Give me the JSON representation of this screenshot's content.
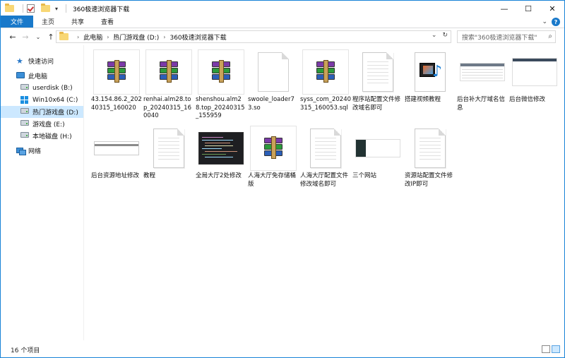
{
  "window": {
    "title": "360极速浏览器下载",
    "controls": [
      "minimize",
      "maximize",
      "close"
    ]
  },
  "ribbon": {
    "tabs": [
      "文件",
      "主页",
      "共享",
      "查看"
    ]
  },
  "address": {
    "crumbs": [
      "此电脑",
      "热门游戏盘 (D:)",
      "360极速浏览器下载"
    ],
    "search_placeholder": "搜索\"360极速浏览器下载\""
  },
  "sidebar": {
    "items": [
      {
        "label": "快速访问",
        "icon": "star-icon"
      },
      {
        "label": "此电脑",
        "icon": "pc-icon"
      },
      {
        "label": "userdisk (B:)",
        "icon": "drive-icon"
      },
      {
        "label": "Win10x64 (C:)",
        "icon": "windows-drive-icon"
      },
      {
        "label": "热门游戏盘 (D:)",
        "icon": "drive-icon",
        "selected": true
      },
      {
        "label": "游戏盘 (E:)",
        "icon": "drive-icon"
      },
      {
        "label": "本地磁盘 (H:)",
        "icon": "drive-icon"
      },
      {
        "label": "网络",
        "icon": "network-icon"
      }
    ]
  },
  "files": [
    {
      "name": "43.154.86.2_20240315_160020",
      "icon": "winrar-archive-icon"
    },
    {
      "name": "renhai.alm28.top_20240315_160040",
      "icon": "winrar-archive-icon"
    },
    {
      "name": "shenshou.alm28.top_20240315_155959",
      "icon": "winrar-archive-icon"
    },
    {
      "name": "swoole_loader73.so",
      "icon": "blank-file-icon"
    },
    {
      "name": "syss_com_20240315_160053.sql",
      "icon": "winrar-archive-icon"
    },
    {
      "name": "程序站配置文件修改域名即可",
      "icon": "text-document-icon"
    },
    {
      "name": "搭建视频教程",
      "icon": "video-file-icon"
    },
    {
      "name": "后台补大厅域名信息",
      "icon": "screenshot-thumbnail"
    },
    {
      "name": "后台微信修改",
      "icon": "screenshot-thumbnail"
    },
    {
      "name": "后台资源地址修改",
      "icon": "screenshot-thumbnail"
    },
    {
      "name": "教程",
      "icon": "text-document-icon"
    },
    {
      "name": "全局大厅2处修改",
      "icon": "code-screenshot-thumbnail"
    },
    {
      "name": "人海大厅免存储桶版",
      "icon": "winrar-archive-icon"
    },
    {
      "name": "人海大厅配置文件修改域名即可",
      "icon": "text-document-icon"
    },
    {
      "name": "三个网站",
      "icon": "screenshot-thumbnail"
    },
    {
      "name": "资源站配置文件修改IP即可",
      "icon": "text-document-icon"
    }
  ],
  "status": {
    "count_text": "16 个项目"
  }
}
